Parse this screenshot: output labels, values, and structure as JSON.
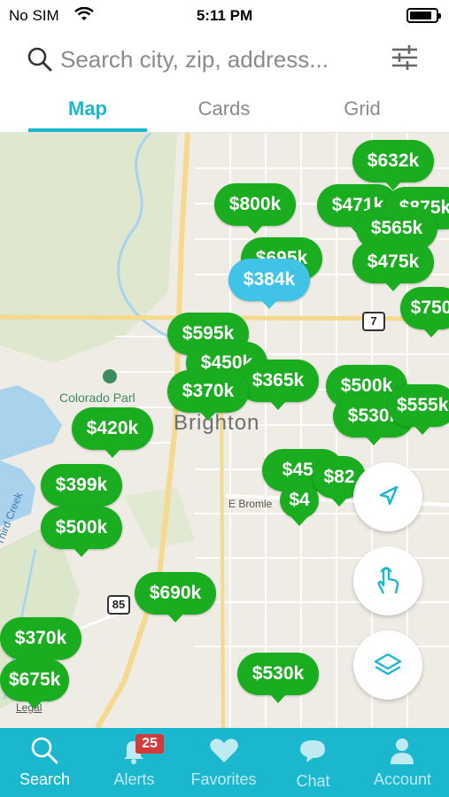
{
  "status_bar": {
    "carrier": "No SIM",
    "time": "5:11 PM"
  },
  "search": {
    "placeholder": "Search city, zip, address..."
  },
  "tabs": [
    {
      "label": "Map",
      "active": true
    },
    {
      "label": "Cards",
      "active": false
    },
    {
      "label": "Grid",
      "active": false
    }
  ],
  "map": {
    "labels": {
      "park": "Colorado Parl",
      "city": "Brighton",
      "street": "E Bromle",
      "creek": "Third Creek",
      "legal": "Legal"
    },
    "route_shields": [
      "7",
      "85"
    ],
    "price_pins": [
      "$632k",
      "$800k",
      "$471k",
      "$875k",
      "$565k",
      "$475k",
      "$695k",
      "$384k",
      "$750",
      "$595k",
      "$450k",
      "$365k",
      "$370k",
      "$500k",
      "$530k",
      "$555k",
      "$420k",
      "$454",
      "$82",
      "$4",
      "$399k",
      "$500k",
      "$690k",
      "$370k",
      "$675k",
      "$530k"
    ],
    "selected_pin": "$384k"
  },
  "bottom_nav": [
    {
      "label": "Search",
      "icon": "search-icon",
      "active": true
    },
    {
      "label": "Alerts",
      "icon": "bell-icon",
      "badge": "25",
      "active": false
    },
    {
      "label": "Favorites",
      "icon": "heart-icon",
      "active": false
    },
    {
      "label": "Chat",
      "icon": "chat-icon",
      "active": false
    },
    {
      "label": "Account",
      "icon": "person-icon",
      "active": false
    }
  ],
  "colors": {
    "accent": "#1bb7cf",
    "pin": "#1aad1f",
    "pin_selected": "#3fc3e6",
    "badge": "#d33a3a"
  }
}
